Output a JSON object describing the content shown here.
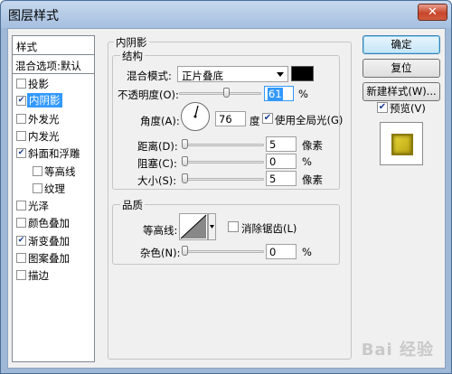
{
  "window": {
    "title": "图层样式",
    "close_label": "✕"
  },
  "styles": {
    "header": "样式",
    "blend_default": "混合选项:默认",
    "items": [
      {
        "label": "投影",
        "checked": false,
        "sub": false,
        "selected": false
      },
      {
        "label": "内阴影",
        "checked": true,
        "sub": false,
        "selected": true
      },
      {
        "label": "外发光",
        "checked": false,
        "sub": false,
        "selected": false
      },
      {
        "label": "内发光",
        "checked": false,
        "sub": false,
        "selected": false
      },
      {
        "label": "斜面和浮雕",
        "checked": true,
        "sub": false,
        "selected": false
      },
      {
        "label": "等高线",
        "checked": false,
        "sub": true,
        "selected": false
      },
      {
        "label": "纹理",
        "checked": false,
        "sub": true,
        "selected": false
      },
      {
        "label": "光泽",
        "checked": false,
        "sub": false,
        "selected": false
      },
      {
        "label": "颜色叠加",
        "checked": false,
        "sub": false,
        "selected": false
      },
      {
        "label": "渐变叠加",
        "checked": true,
        "sub": false,
        "selected": false
      },
      {
        "label": "图案叠加",
        "checked": false,
        "sub": false,
        "selected": false
      },
      {
        "label": "描边",
        "checked": false,
        "sub": false,
        "selected": false
      }
    ]
  },
  "inner_shadow": {
    "title": "内阴影",
    "structure": {
      "title": "结构",
      "blend_mode_label": "混合模式:",
      "blend_mode_value": "正片叠底",
      "blend_color": "#000000",
      "opacity_label": "不透明度(O):",
      "opacity_value": "61",
      "opacity_unit": "%",
      "angle_label": "角度(A):",
      "angle_value": "76",
      "angle_unit": "度",
      "global_light_label": "使用全局光(G)",
      "global_light_checked": true,
      "distance_label": "距离(D):",
      "distance_value": "5",
      "distance_unit": "像素",
      "choke_label": "阻塞(C):",
      "choke_value": "0",
      "choke_unit": "%",
      "size_label": "大小(S):",
      "size_value": "5",
      "size_unit": "像素"
    },
    "quality": {
      "title": "品质",
      "contour_label": "等高线:",
      "anti_alias_label": "消除锯齿(L)",
      "anti_alias_checked": false,
      "noise_label": "杂色(N):",
      "noise_value": "0",
      "noise_unit": "%"
    }
  },
  "buttons": {
    "ok": "确定",
    "reset": "复位",
    "new_style": "新建样式(W)...",
    "preview_label": "预览(V)",
    "preview_checked": true
  },
  "watermark": "Bai 经验"
}
